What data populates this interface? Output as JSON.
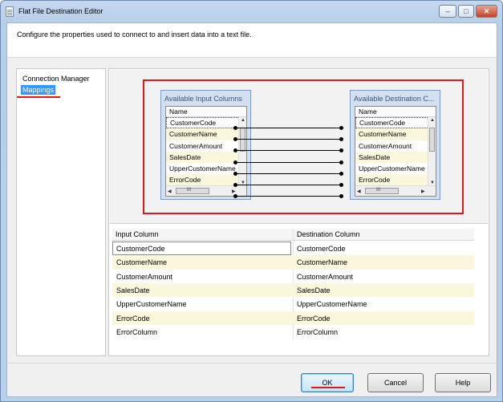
{
  "window": {
    "title": "Flat File Destination Editor",
    "controls": {
      "minimize": "‒",
      "maximize": "□",
      "close": "✕"
    }
  },
  "header": {
    "description": "Configure the properties used to connect to and insert data into a text file."
  },
  "nav": {
    "items": [
      {
        "label": "Connection Manager",
        "selected": false
      },
      {
        "label": "Mappings",
        "selected": true
      }
    ]
  },
  "diagram": {
    "input_box": {
      "title": "Available Input Columns",
      "header": "Name",
      "rows": [
        "CustomerCode",
        "CustomerName",
        "CustomerAmount",
        "SalesDate",
        "UpperCustomerName",
        "ErrorCode"
      ],
      "scroll_glyph": "III"
    },
    "destination_box": {
      "title": "Available Destination C...",
      "header": "Name",
      "rows": [
        "CustomerCode",
        "CustomerName",
        "CustomerAmount",
        "SalesDate",
        "UpperCustomerName",
        "ErrorCode"
      ],
      "scroll_glyph": "III"
    },
    "mapping_count": 7
  },
  "mapping_grid": {
    "columns": [
      "Input Column",
      "Destination Column"
    ],
    "rows": [
      {
        "input": "CustomerCode",
        "destination": "CustomerCode"
      },
      {
        "input": "CustomerName",
        "destination": "CustomerName"
      },
      {
        "input": "CustomerAmount",
        "destination": "CustomerAmount"
      },
      {
        "input": "SalesDate",
        "destination": "SalesDate"
      },
      {
        "input": "UpperCustomerName",
        "destination": "UpperCustomerName"
      },
      {
        "input": "ErrorCode",
        "destination": "ErrorCode"
      },
      {
        "input": "ErrorColumn",
        "destination": "ErrorColumn"
      }
    ]
  },
  "buttons": {
    "ok": "OK",
    "cancel": "Cancel",
    "help": "Help"
  },
  "colors": {
    "accent_highlight": "#e01818",
    "selection": "#3399ff",
    "alt_row": "#fbf7dc"
  }
}
